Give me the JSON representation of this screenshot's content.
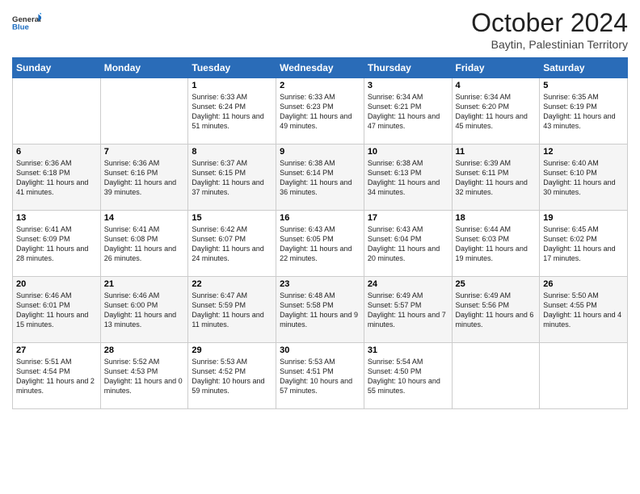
{
  "logo": {
    "general": "General",
    "blue": "Blue"
  },
  "header": {
    "month": "October 2024",
    "location": "Baytin, Palestinian Territory"
  },
  "days_of_week": [
    "Sunday",
    "Monday",
    "Tuesday",
    "Wednesday",
    "Thursday",
    "Friday",
    "Saturday"
  ],
  "weeks": [
    [
      {
        "day": null,
        "info": null
      },
      {
        "day": null,
        "info": null
      },
      {
        "day": "1",
        "sunrise": "6:33 AM",
        "sunset": "6:24 PM",
        "daylight": "11 hours and 51 minutes."
      },
      {
        "day": "2",
        "sunrise": "6:33 AM",
        "sunset": "6:23 PM",
        "daylight": "11 hours and 49 minutes."
      },
      {
        "day": "3",
        "sunrise": "6:34 AM",
        "sunset": "6:21 PM",
        "daylight": "11 hours and 47 minutes."
      },
      {
        "day": "4",
        "sunrise": "6:34 AM",
        "sunset": "6:20 PM",
        "daylight": "11 hours and 45 minutes."
      },
      {
        "day": "5",
        "sunrise": "6:35 AM",
        "sunset": "6:19 PM",
        "daylight": "11 hours and 43 minutes."
      }
    ],
    [
      {
        "day": "6",
        "sunrise": "6:36 AM",
        "sunset": "6:18 PM",
        "daylight": "11 hours and 41 minutes."
      },
      {
        "day": "7",
        "sunrise": "6:36 AM",
        "sunset": "6:16 PM",
        "daylight": "11 hours and 39 minutes."
      },
      {
        "day": "8",
        "sunrise": "6:37 AM",
        "sunset": "6:15 PM",
        "daylight": "11 hours and 37 minutes."
      },
      {
        "day": "9",
        "sunrise": "6:38 AM",
        "sunset": "6:14 PM",
        "daylight": "11 hours and 36 minutes."
      },
      {
        "day": "10",
        "sunrise": "6:38 AM",
        "sunset": "6:13 PM",
        "daylight": "11 hours and 34 minutes."
      },
      {
        "day": "11",
        "sunrise": "6:39 AM",
        "sunset": "6:11 PM",
        "daylight": "11 hours and 32 minutes."
      },
      {
        "day": "12",
        "sunrise": "6:40 AM",
        "sunset": "6:10 PM",
        "daylight": "11 hours and 30 minutes."
      }
    ],
    [
      {
        "day": "13",
        "sunrise": "6:41 AM",
        "sunset": "6:09 PM",
        "daylight": "11 hours and 28 minutes."
      },
      {
        "day": "14",
        "sunrise": "6:41 AM",
        "sunset": "6:08 PM",
        "daylight": "11 hours and 26 minutes."
      },
      {
        "day": "15",
        "sunrise": "6:42 AM",
        "sunset": "6:07 PM",
        "daylight": "11 hours and 24 minutes."
      },
      {
        "day": "16",
        "sunrise": "6:43 AM",
        "sunset": "6:05 PM",
        "daylight": "11 hours and 22 minutes."
      },
      {
        "day": "17",
        "sunrise": "6:43 AM",
        "sunset": "6:04 PM",
        "daylight": "11 hours and 20 minutes."
      },
      {
        "day": "18",
        "sunrise": "6:44 AM",
        "sunset": "6:03 PM",
        "daylight": "11 hours and 19 minutes."
      },
      {
        "day": "19",
        "sunrise": "6:45 AM",
        "sunset": "6:02 PM",
        "daylight": "11 hours and 17 minutes."
      }
    ],
    [
      {
        "day": "20",
        "sunrise": "6:46 AM",
        "sunset": "6:01 PM",
        "daylight": "11 hours and 15 minutes."
      },
      {
        "day": "21",
        "sunrise": "6:46 AM",
        "sunset": "6:00 PM",
        "daylight": "11 hours and 13 minutes."
      },
      {
        "day": "22",
        "sunrise": "6:47 AM",
        "sunset": "5:59 PM",
        "daylight": "11 hours and 11 minutes."
      },
      {
        "day": "23",
        "sunrise": "6:48 AM",
        "sunset": "5:58 PM",
        "daylight": "11 hours and 9 minutes."
      },
      {
        "day": "24",
        "sunrise": "6:49 AM",
        "sunset": "5:57 PM",
        "daylight": "11 hours and 7 minutes."
      },
      {
        "day": "25",
        "sunrise": "6:49 AM",
        "sunset": "5:56 PM",
        "daylight": "11 hours and 6 minutes."
      },
      {
        "day": "26",
        "sunrise": "5:50 AM",
        "sunset": "4:55 PM",
        "daylight": "11 hours and 4 minutes."
      }
    ],
    [
      {
        "day": "27",
        "sunrise": "5:51 AM",
        "sunset": "4:54 PM",
        "daylight": "11 hours and 2 minutes."
      },
      {
        "day": "28",
        "sunrise": "5:52 AM",
        "sunset": "4:53 PM",
        "daylight": "11 hours and 0 minutes."
      },
      {
        "day": "29",
        "sunrise": "5:53 AM",
        "sunset": "4:52 PM",
        "daylight": "10 hours and 59 minutes."
      },
      {
        "day": "30",
        "sunrise": "5:53 AM",
        "sunset": "4:51 PM",
        "daylight": "10 hours and 57 minutes."
      },
      {
        "day": "31",
        "sunrise": "5:54 AM",
        "sunset": "4:50 PM",
        "daylight": "10 hours and 55 minutes."
      },
      {
        "day": null,
        "info": null
      },
      {
        "day": null,
        "info": null
      }
    ]
  ],
  "labels": {
    "sunrise": "Sunrise:",
    "sunset": "Sunset:",
    "daylight": "Daylight:"
  }
}
